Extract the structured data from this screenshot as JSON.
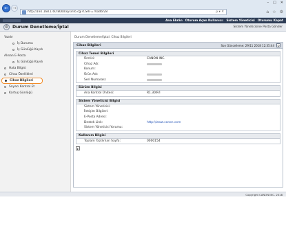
{
  "browser": {
    "url": "http://192.168.1.60:8000/sysinfo.cgi?CSRF=70ad6f28",
    "back_icon": "←",
    "forward_icon": "→",
    "address_tools": "ρ ▾ ✕",
    "window_controls": [
      "–",
      "□",
      "✕"
    ],
    "toolbar_icons": [
      "⌂",
      "☆",
      "⚙"
    ]
  },
  "header": {
    "links": [
      "Ana Ekrân",
      "Oturum Açan Kullanıcı:",
      "Sistem Yöneticisi",
      "Oturumu Kapat"
    ]
  },
  "titlebar": {
    "title": "Durum Denetleme/İptal",
    "right_link": "Sistem Yöneticisine Posta Gönder"
  },
  "sidebar": {
    "items": [
      {
        "label": "Yazdır",
        "level": "heading"
      },
      {
        "label": "İş Durumu",
        "level": "sub"
      },
      {
        "label": "İş Günlüğü Kaydı",
        "level": "sub"
      },
      {
        "label": "Alınan E-Posta",
        "level": "heading"
      },
      {
        "label": "İş Günlüğü Kaydı",
        "level": "sub"
      },
      {
        "label": "Hata Bilgisi",
        "level": "top"
      },
      {
        "label": "Cihaz Özellikleri",
        "level": "top"
      },
      {
        "label": "Cihaz Bilgileri",
        "level": "top"
      },
      {
        "label": "Sayacı Kontrol Et",
        "level": "top"
      },
      {
        "label": "Kartuş Günlüğü",
        "level": "top"
      }
    ]
  },
  "main": {
    "breadcrumb": "Durum Denetleme/İptal: Cihaz Bilgileri",
    "panel_title": "Cihaz Bilgileri",
    "last_updated": "Son Güncelleme: 29/11 2018 12:35:44",
    "refresh_icon": "↻",
    "sections": {
      "basic": {
        "title": "Cihaz Temel Bilgileri",
        "rows": [
          {
            "label": "Üretici:",
            "value": "CANON INC."
          },
          {
            "label": "Cihaz Adı:",
            "value": ""
          },
          {
            "label": "Konum:",
            "value": ""
          },
          {
            "label": "Ürün Adı:",
            "value": ""
          },
          {
            "label": "Seri Numarası:",
            "value": ""
          }
        ]
      },
      "version": {
        "title": "Sürüm Bilgisi",
        "rows": [
          {
            "label": "Ana Kontrol Ünitesi:",
            "value": "R1.30/F/I"
          }
        ]
      },
      "admin": {
        "title": "Sistem Yöneticisi Bilgisi",
        "rows": [
          {
            "label": "Sistem Yöneticisi:",
            "value": ""
          },
          {
            "label": "İletişim Bilgileri:",
            "value": ""
          },
          {
            "label": "E-Posta Adresi:",
            "value": ""
          },
          {
            "label": "Destek Link:",
            "value": "http://www.canon.com"
          },
          {
            "label": "Sistem Yöneticisi Yorumu:",
            "value": ""
          }
        ]
      },
      "usage": {
        "title": "Kullanım Bilgisi",
        "rows": [
          {
            "label": "Toplam Yazdırılan Sayfa:",
            "value": "0000154"
          }
        ],
        "button_icon": "▸"
      }
    }
  },
  "footer": {
    "copyright": "Copyright CANON INC. 2018"
  }
}
